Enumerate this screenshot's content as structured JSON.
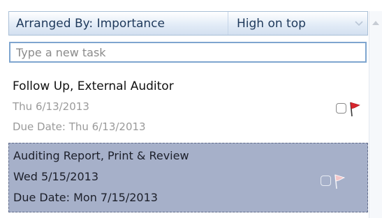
{
  "header": {
    "arrange_label": "Arranged By: Importance",
    "sort_order": "High on top"
  },
  "new_task": {
    "placeholder": "Type a new task"
  },
  "tasks": [
    {
      "subject": "Follow Up, External Auditor",
      "date": "Thu 6/13/2013",
      "due": "Due Date: Thu 6/13/2013",
      "flag_color": "#d9262e",
      "selected": false
    },
    {
      "subject": "Auditing Report, Print & Review",
      "date": "Wed 5/15/2013",
      "due": "Due Date: Mon 7/15/2013",
      "flag_color": "#f4c6c9",
      "selected": true
    }
  ],
  "colors": {
    "header_text": "#1e395b",
    "selection_bg": "#a6b0c9",
    "input_border": "#7ea5cf"
  },
  "icons": {
    "sort_chevron": "chevron-down-icon",
    "scroll_up": "scroll-up-arrow-icon",
    "task_checkbox": "checkbox-icon",
    "task_flag": "follow-up-flag-icon"
  }
}
